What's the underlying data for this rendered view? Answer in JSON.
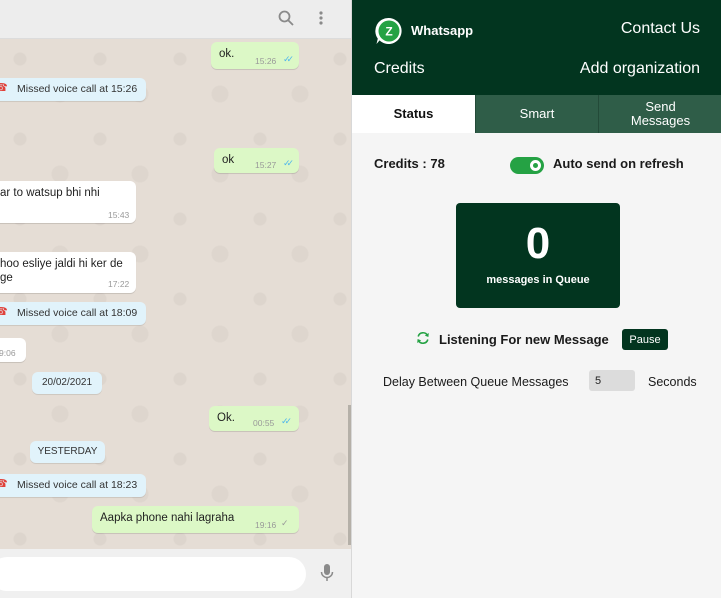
{
  "chat": {
    "messages": [
      {
        "kind": "out",
        "text": "ok.",
        "time": "15:26"
      },
      {
        "kind": "sys",
        "text": "Missed voice call at 15:26"
      },
      {
        "kind": "out",
        "text": "ok",
        "time": "15:27"
      },
      {
        "kind": "in",
        "text": "ar to watsup bhi nhi",
        "time": "15:43"
      },
      {
        "kind": "in",
        "text": "hoo esliye jaldi hi ker de",
        "text2": "ge",
        "time": "17:22"
      },
      {
        "kind": "sys",
        "text": "Missed voice call at 18:09"
      },
      {
        "kind": "in",
        "text": "",
        "time": "9:06"
      },
      {
        "kind": "date",
        "text": "20/02/2021"
      },
      {
        "kind": "out",
        "text": "Ok.",
        "time": "00:55"
      },
      {
        "kind": "date",
        "text": "YESTERDAY"
      },
      {
        "kind": "sys",
        "text": "Missed voice call at 18:23"
      },
      {
        "kind": "out",
        "text": "Aapka phone nahi lagraha",
        "time": "19:16"
      }
    ],
    "composer_placeholder": ""
  },
  "panel": {
    "brand": "Whatsapp",
    "logo_letter": "Z",
    "contact_us": "Contact Us",
    "credits_link": "Credits",
    "add_org": "Add organization",
    "tabs": [
      {
        "label": "Status"
      },
      {
        "label": "Smart"
      },
      {
        "label": "Send\nMessages"
      }
    ],
    "credits_label": "Credits : 78",
    "auto_send_label": "Auto send on refresh",
    "auto_send_on": true,
    "queue_count": "0",
    "queue_label": "messages in Queue",
    "listening": "Listening For new Message",
    "pause": "Pause",
    "delay_label": "Delay Between Queue Messages",
    "delay_value": "5",
    "seconds": "Seconds"
  },
  "colors": {
    "dark_green": "#02351f",
    "tab_green": "#2f5d48",
    "toggle_green": "#25a244",
    "outgoing_bubble": "#dcf8c6",
    "system_bubble": "#e1f3fb"
  }
}
